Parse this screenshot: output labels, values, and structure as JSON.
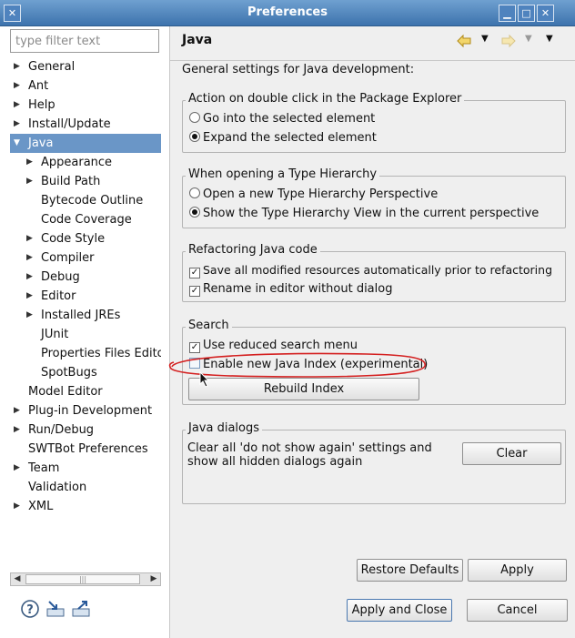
{
  "window": {
    "title": "Preferences"
  },
  "filter": {
    "placeholder": "type filter text"
  },
  "tree": [
    {
      "label": "General",
      "level": 0,
      "arrow": "right"
    },
    {
      "label": "Ant",
      "level": 0,
      "arrow": "right"
    },
    {
      "label": "Help",
      "level": 0,
      "arrow": "right"
    },
    {
      "label": "Install/Update",
      "level": 0,
      "arrow": "right"
    },
    {
      "label": "Java",
      "level": 0,
      "arrow": "down",
      "selected": true
    },
    {
      "label": "Appearance",
      "level": 1,
      "arrow": "right"
    },
    {
      "label": "Build Path",
      "level": 1,
      "arrow": "right"
    },
    {
      "label": "Bytecode Outline",
      "level": 1,
      "arrow": ""
    },
    {
      "label": "Code Coverage",
      "level": 1,
      "arrow": ""
    },
    {
      "label": "Code Style",
      "level": 1,
      "arrow": "right"
    },
    {
      "label": "Compiler",
      "level": 1,
      "arrow": "right"
    },
    {
      "label": "Debug",
      "level": 1,
      "arrow": "right"
    },
    {
      "label": "Editor",
      "level": 1,
      "arrow": "right"
    },
    {
      "label": "Installed JREs",
      "level": 1,
      "arrow": "right"
    },
    {
      "label": "JUnit",
      "level": 1,
      "arrow": ""
    },
    {
      "label": "Properties Files Edito",
      "level": 1,
      "arrow": ""
    },
    {
      "label": "SpotBugs",
      "level": 1,
      "arrow": ""
    },
    {
      "label": "Model Editor",
      "level": 0,
      "arrow": ""
    },
    {
      "label": "Plug-in Development",
      "level": 0,
      "arrow": "right"
    },
    {
      "label": "Run/Debug",
      "level": 0,
      "arrow": "right"
    },
    {
      "label": "SWTBot Preferences",
      "level": 0,
      "arrow": ""
    },
    {
      "label": "Team",
      "level": 0,
      "arrow": "right"
    },
    {
      "label": "Validation",
      "level": 0,
      "arrow": ""
    },
    {
      "label": "XML",
      "level": 0,
      "arrow": "right"
    }
  ],
  "page": {
    "title": "Java",
    "description": "General settings for Java development:",
    "groups": {
      "double_click": {
        "title": "Action on double click in the Package Explorer",
        "options": [
          {
            "label": "Go into the selected element",
            "checked": false
          },
          {
            "label": "Expand the selected element",
            "checked": true
          }
        ]
      },
      "type_hierarchy": {
        "title": "When opening a Type Hierarchy",
        "options": [
          {
            "label": "Open a new Type Hierarchy Perspective",
            "checked": false
          },
          {
            "label": "Show the Type Hierarchy View in the current perspective",
            "checked": true
          }
        ]
      },
      "refactoring": {
        "title": "Refactoring Java code",
        "options": [
          {
            "label": "Save all modified resources automatically prior to refactoring",
            "checked": true
          },
          {
            "label": "Rename in editor without dialog",
            "checked": true
          }
        ]
      },
      "search": {
        "title": "Search",
        "options": [
          {
            "label": "Use reduced search menu",
            "checked": true
          },
          {
            "label": "Enable new Java Index (experimental)",
            "checked": false
          }
        ],
        "rebuild_label": "Rebuild Index"
      },
      "java_dialogs": {
        "title": "Java dialogs",
        "text": "Clear all 'do not show again' settings and show all hidden dialogs again",
        "clear_label": "Clear"
      }
    },
    "restore_defaults_label": "Restore Defaults",
    "apply_label": "Apply"
  },
  "footer": {
    "apply_close_label": "Apply and Close",
    "cancel_label": "Cancel"
  },
  "colors": {
    "selection": "#6a96c7",
    "titlebar": "#3d73ad",
    "annotation": "#d42020"
  },
  "icons": [
    "help-icon",
    "import-icon",
    "export-icon",
    "back-arrow-icon",
    "forward-arrow-icon",
    "view-menu-icon"
  ]
}
